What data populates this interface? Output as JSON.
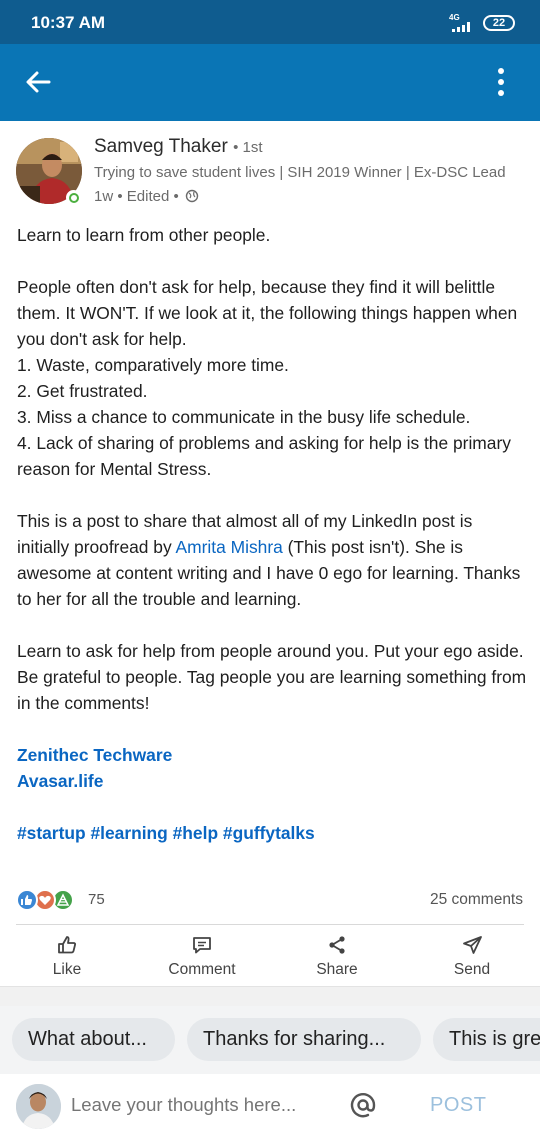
{
  "status_bar": {
    "time": "10:37 AM",
    "network": "4G",
    "battery": "22"
  },
  "post": {
    "author": {
      "name": "Samveg Thaker",
      "degree": "• 1st",
      "headline": "Trying to save student lives | SIH 2019 Winner | Ex-DSC Lead",
      "meta": "1w • Edited •",
      "visibility_icon": "globe-icon"
    },
    "text": {
      "p1": "Learn to learn from other people.",
      "p2_lines": [
        "People often don't ask for help, because they find it will belittle them. It WON'T. If we look at it, the following things happen when you don't ask for help.",
        "1. Waste, comparatively more time.",
        "2. Get frustrated.",
        "3. Miss a chance to communicate in the busy life schedule.",
        "4. Lack of sharing of problems and asking for help is the primary reason for Mental Stress."
      ],
      "p3_before": "This is a post to share that almost all of my LinkedIn post is initially proofread by ",
      "p3_mention": "Amrita Mishra",
      "p3_after": " (This post isn't). She is awesome at content writing and I have 0 ego for learning. Thanks to her for all the trouble and learning.",
      "p4": "Learn to ask for help from people around you. Put your ego aside. Be grateful to people. Tag people you are learning something from in the comments!",
      "orgs": [
        "Zenithec Techware",
        "Avasar.life"
      ],
      "hashtags": [
        "#startup",
        "#learning",
        "#help",
        "#guffytalks"
      ]
    },
    "reactions": {
      "count": "75",
      "comments": "25 comments",
      "icons": [
        "like-icon",
        "love-icon",
        "celebrate-icon"
      ]
    }
  },
  "actions": [
    {
      "label": "Like",
      "icon": "thumbs-up-icon"
    },
    {
      "label": "Comment",
      "icon": "comment-icon"
    },
    {
      "label": "Share",
      "icon": "share-icon"
    },
    {
      "label": "Send",
      "icon": "send-icon"
    }
  ],
  "suggestions": [
    "What about...",
    "Thanks for sharing...",
    "This is great..."
  ],
  "composer": {
    "placeholder": "Leave your thoughts here...",
    "post_label": "POST"
  },
  "colors": {
    "status_bar": "#0f5c8f",
    "app_bar": "#0a75b5",
    "link": "#0a66c2",
    "online": "#4caf3f"
  }
}
